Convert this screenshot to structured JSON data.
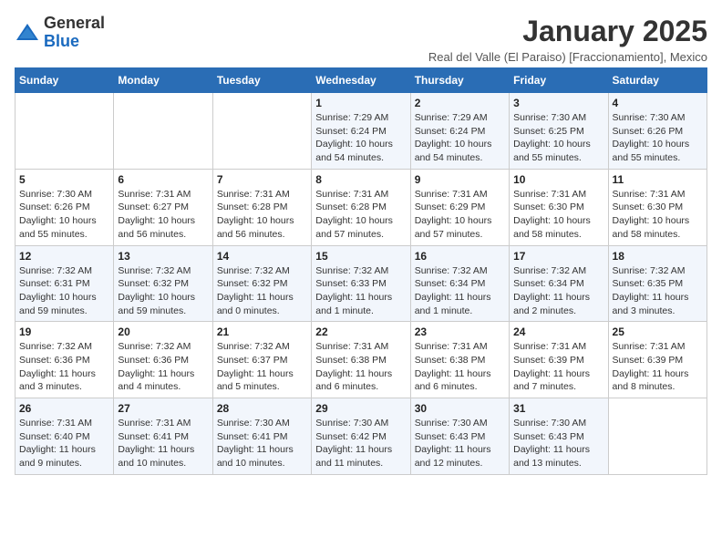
{
  "header": {
    "logo_general": "General",
    "logo_blue": "Blue",
    "title": "January 2025",
    "subtitle": "Real del Valle (El Paraiso) [Fraccionamiento], Mexico"
  },
  "days_of_week": [
    "Sunday",
    "Monday",
    "Tuesday",
    "Wednesday",
    "Thursday",
    "Friday",
    "Saturday"
  ],
  "weeks": [
    [
      {
        "day": "",
        "info": ""
      },
      {
        "day": "",
        "info": ""
      },
      {
        "day": "",
        "info": ""
      },
      {
        "day": "1",
        "info": "Sunrise: 7:29 AM\nSunset: 6:24 PM\nDaylight: 10 hours and 54 minutes."
      },
      {
        "day": "2",
        "info": "Sunrise: 7:29 AM\nSunset: 6:24 PM\nDaylight: 10 hours and 54 minutes."
      },
      {
        "day": "3",
        "info": "Sunrise: 7:30 AM\nSunset: 6:25 PM\nDaylight: 10 hours and 55 minutes."
      },
      {
        "day": "4",
        "info": "Sunrise: 7:30 AM\nSunset: 6:26 PM\nDaylight: 10 hours and 55 minutes."
      }
    ],
    [
      {
        "day": "5",
        "info": "Sunrise: 7:30 AM\nSunset: 6:26 PM\nDaylight: 10 hours and 55 minutes."
      },
      {
        "day": "6",
        "info": "Sunrise: 7:31 AM\nSunset: 6:27 PM\nDaylight: 10 hours and 56 minutes."
      },
      {
        "day": "7",
        "info": "Sunrise: 7:31 AM\nSunset: 6:28 PM\nDaylight: 10 hours and 56 minutes."
      },
      {
        "day": "8",
        "info": "Sunrise: 7:31 AM\nSunset: 6:28 PM\nDaylight: 10 hours and 57 minutes."
      },
      {
        "day": "9",
        "info": "Sunrise: 7:31 AM\nSunset: 6:29 PM\nDaylight: 10 hours and 57 minutes."
      },
      {
        "day": "10",
        "info": "Sunrise: 7:31 AM\nSunset: 6:30 PM\nDaylight: 10 hours and 58 minutes."
      },
      {
        "day": "11",
        "info": "Sunrise: 7:31 AM\nSunset: 6:30 PM\nDaylight: 10 hours and 58 minutes."
      }
    ],
    [
      {
        "day": "12",
        "info": "Sunrise: 7:32 AM\nSunset: 6:31 PM\nDaylight: 10 hours and 59 minutes."
      },
      {
        "day": "13",
        "info": "Sunrise: 7:32 AM\nSunset: 6:32 PM\nDaylight: 10 hours and 59 minutes."
      },
      {
        "day": "14",
        "info": "Sunrise: 7:32 AM\nSunset: 6:32 PM\nDaylight: 11 hours and 0 minutes."
      },
      {
        "day": "15",
        "info": "Sunrise: 7:32 AM\nSunset: 6:33 PM\nDaylight: 11 hours and 1 minute."
      },
      {
        "day": "16",
        "info": "Sunrise: 7:32 AM\nSunset: 6:34 PM\nDaylight: 11 hours and 1 minute."
      },
      {
        "day": "17",
        "info": "Sunrise: 7:32 AM\nSunset: 6:34 PM\nDaylight: 11 hours and 2 minutes."
      },
      {
        "day": "18",
        "info": "Sunrise: 7:32 AM\nSunset: 6:35 PM\nDaylight: 11 hours and 3 minutes."
      }
    ],
    [
      {
        "day": "19",
        "info": "Sunrise: 7:32 AM\nSunset: 6:36 PM\nDaylight: 11 hours and 3 minutes."
      },
      {
        "day": "20",
        "info": "Sunrise: 7:32 AM\nSunset: 6:36 PM\nDaylight: 11 hours and 4 minutes."
      },
      {
        "day": "21",
        "info": "Sunrise: 7:32 AM\nSunset: 6:37 PM\nDaylight: 11 hours and 5 minutes."
      },
      {
        "day": "22",
        "info": "Sunrise: 7:31 AM\nSunset: 6:38 PM\nDaylight: 11 hours and 6 minutes."
      },
      {
        "day": "23",
        "info": "Sunrise: 7:31 AM\nSunset: 6:38 PM\nDaylight: 11 hours and 6 minutes."
      },
      {
        "day": "24",
        "info": "Sunrise: 7:31 AM\nSunset: 6:39 PM\nDaylight: 11 hours and 7 minutes."
      },
      {
        "day": "25",
        "info": "Sunrise: 7:31 AM\nSunset: 6:39 PM\nDaylight: 11 hours and 8 minutes."
      }
    ],
    [
      {
        "day": "26",
        "info": "Sunrise: 7:31 AM\nSunset: 6:40 PM\nDaylight: 11 hours and 9 minutes."
      },
      {
        "day": "27",
        "info": "Sunrise: 7:31 AM\nSunset: 6:41 PM\nDaylight: 11 hours and 10 minutes."
      },
      {
        "day": "28",
        "info": "Sunrise: 7:30 AM\nSunset: 6:41 PM\nDaylight: 11 hours and 10 minutes."
      },
      {
        "day": "29",
        "info": "Sunrise: 7:30 AM\nSunset: 6:42 PM\nDaylight: 11 hours and 11 minutes."
      },
      {
        "day": "30",
        "info": "Sunrise: 7:30 AM\nSunset: 6:43 PM\nDaylight: 11 hours and 12 minutes."
      },
      {
        "day": "31",
        "info": "Sunrise: 7:30 AM\nSunset: 6:43 PM\nDaylight: 11 hours and 13 minutes."
      },
      {
        "day": "",
        "info": ""
      }
    ]
  ]
}
